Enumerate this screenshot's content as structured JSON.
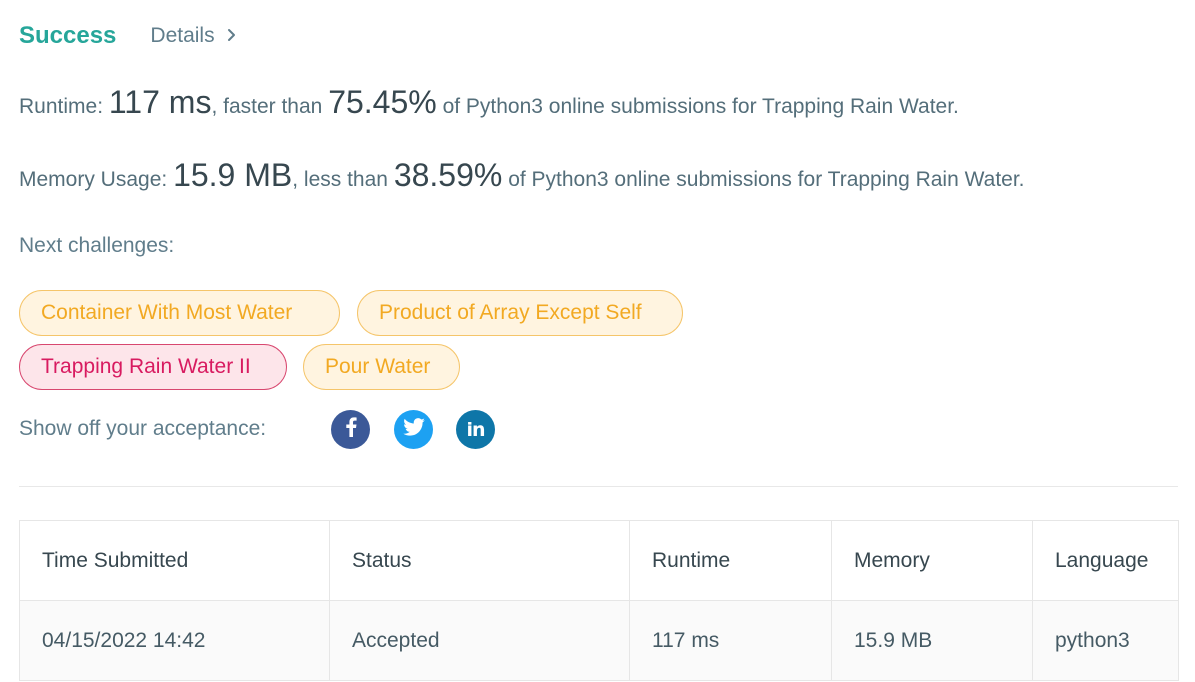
{
  "header": {
    "status": "Success",
    "details_label": "Details"
  },
  "runtime": {
    "label": "Runtime:",
    "value": "117 ms",
    "mid_text": ", faster than",
    "percent": "75.45%",
    "suffix": "of Python3 online submissions for Trapping Rain Water."
  },
  "memory": {
    "label": "Memory Usage:",
    "value": "15.9 MB",
    "mid_text": ", less than",
    "percent": "38.59%",
    "suffix": "of Python3 online submissions for Trapping Rain Water."
  },
  "next_challenges": {
    "label": "Next challenges:",
    "items": [
      {
        "label": "Container With Most Water",
        "difficulty": "medium"
      },
      {
        "label": "Product of Array Except Self",
        "difficulty": "medium"
      },
      {
        "label": "Trapping Rain Water II",
        "difficulty": "hard"
      },
      {
        "label": "Pour Water",
        "difficulty": "medium"
      }
    ]
  },
  "share": {
    "label": "Show off your acceptance:",
    "icons": [
      "facebook-icon",
      "twitter-icon",
      "linkedin-icon"
    ],
    "linkedin_text": "in"
  },
  "table": {
    "headers": [
      "Time Submitted",
      "Status",
      "Runtime",
      "Memory",
      "Language"
    ],
    "rows": [
      [
        "04/15/2022 14:42",
        "Accepted",
        "117 ms",
        "15.9 MB",
        "python3"
      ]
    ]
  },
  "colors": {
    "success": "#26a69a",
    "medium": "#f2a922",
    "hard": "#d81b60",
    "facebook": "#3b5998",
    "twitter": "#1da1f2",
    "linkedin": "#0e76a8"
  }
}
